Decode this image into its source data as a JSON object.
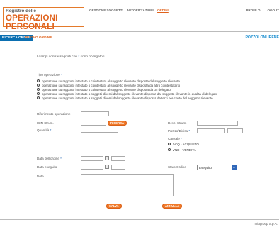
{
  "header": {
    "logo_line1": "Registro delle",
    "logo_line2": "OPERAZIONI PERSONALI",
    "nav": [
      "GESTIONE SOGGETTI",
      "AUTORIZZAZIONI",
      "ORDINI"
    ],
    "right_nav": [
      "PROFILO",
      "LOGOUT"
    ]
  },
  "tabs": {
    "tab1": "RICERCA ORDINI",
    "tab2": "NUOVO ORDINE"
  },
  "position_label": "POZZOLONI IRENE",
  "note_prefix": "I campi contrassegnati con",
  "note_suffix": "sono obbligatori.",
  "required_mark": "*",
  "tipo_label": "Tipo operazione",
  "radio_options": [
    "operazione su rapporto intestato o cointestato al soggetto rilevante disposta dal soggetto rilevante",
    "operazione su rapporto intestato o cointestato al soggetto rilevante disposta da altro cointestatario",
    "operazione su rapporto intestato o cointestato al soggetto rilevante disposta da un delegato",
    "operazione su rapporto intestato a soggetti diversi dal soggetto rilevante disposta dal soggetto rilevante in qualità di delegato",
    "operazione su rapporto intestato a soggetti diversi dal soggetto rilevante disposta da terzi per conto del soggetto rilevante"
  ],
  "labels": {
    "riferimento": "Riferimento operazione",
    "isin": "ISIN Strum.",
    "quantita": "Quantità",
    "desc": "Desc. Strum.",
    "prezzo": "Prezzo/Divisa",
    "causale": "Causale",
    "acquisto": "ACQ - ACQUISTO",
    "vendita": "VND - VENDITA",
    "data_ordine": "Data dell'ordine",
    "data_eseguito": "Data eseguito",
    "stato": "Stato Ordine",
    "note": "Note"
  },
  "stato_value": "Eseguito",
  "buttons": {
    "ricerca": "RICERCA",
    "salva": "SALVA",
    "annulla": "ANNULLA"
  },
  "footer": "Infogroup S.p.A."
}
